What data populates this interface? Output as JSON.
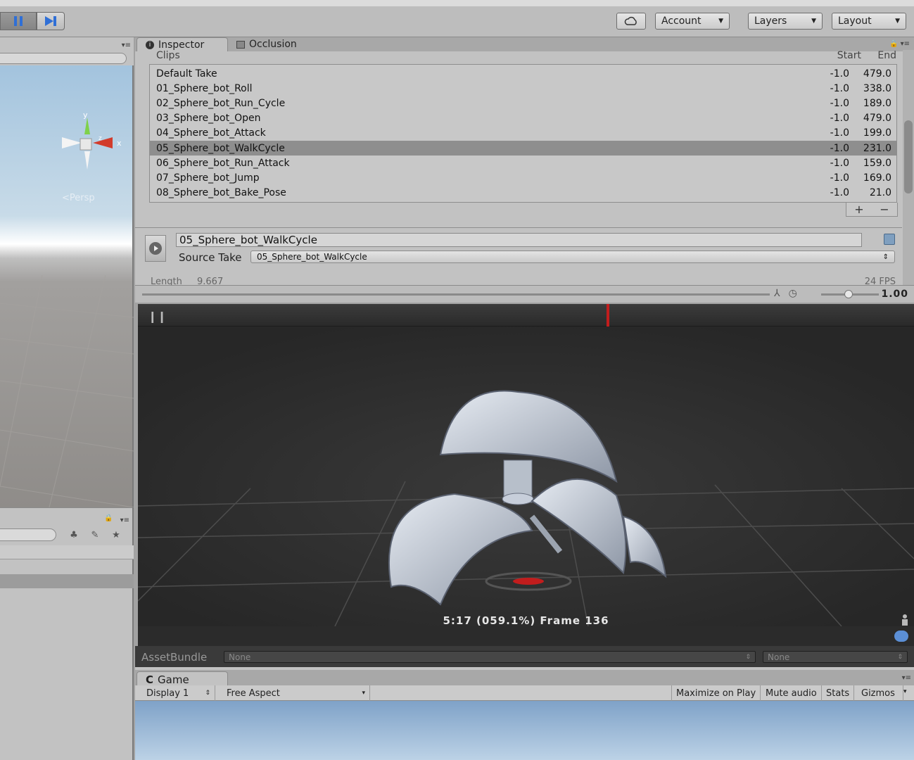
{
  "toolbar": {
    "pause_icon": "pause-icon",
    "step_icon": "step-icon",
    "cloud_icon": "cloud-icon",
    "account_label": "Account",
    "layers_label": "Layers",
    "layout_label": "Layout"
  },
  "scene": {
    "persp_label": "Persp",
    "gizmo_axes": [
      "y",
      "x",
      "z"
    ]
  },
  "inspector": {
    "tabs": [
      {
        "label": "Inspector",
        "icon": "info-icon"
      },
      {
        "label": "Occlusion",
        "icon": "occlusion-icon"
      }
    ],
    "clips": {
      "header": "Clips",
      "start_label": "Start",
      "end_label": "End",
      "rows": [
        {
          "name": "Default Take",
          "start": "-1.0",
          "end": "479.0"
        },
        {
          "name": "01_Sphere_bot_Roll",
          "start": "-1.0",
          "end": "338.0"
        },
        {
          "name": "02_Sphere_bot_Run_Cycle",
          "start": "-1.0",
          "end": "189.0"
        },
        {
          "name": "03_Sphere_bot_Open",
          "start": "-1.0",
          "end": "479.0"
        },
        {
          "name": "04_Sphere_bot_Attack",
          "start": "-1.0",
          "end": "199.0"
        },
        {
          "name": "05_Sphere_bot_WalkCycle",
          "start": "-1.0",
          "end": "231.0"
        },
        {
          "name": "06_Sphere_bot_Run_Attack",
          "start": "-1.0",
          "end": "159.0"
        },
        {
          "name": "07_Sphere_bot_Jump",
          "start": "-1.0",
          "end": "169.0"
        },
        {
          "name": "08_Sphere_bot_Bake_Pose",
          "start": "-1.0",
          "end": "21.0"
        }
      ],
      "selected_index": 5,
      "add_label": "+",
      "remove_label": "−"
    },
    "clip_editor": {
      "name_value": "05_Sphere_bot_WalkCycle",
      "source_take_label": "Source Take",
      "source_take_value": "05_Sphere_bot_WalkCycle",
      "length_label": "Length",
      "length_value": "9.667",
      "fps": "24 FPS"
    }
  },
  "timeline": {
    "speed_value": "1.00"
  },
  "preview": {
    "frame_text": "5:17 (059.1%) Frame 136"
  },
  "assetbundle": {
    "label": "AssetBundle",
    "name_value": "None",
    "variant_value": "None"
  },
  "game": {
    "tab_label": "Game",
    "display_value": "Display 1",
    "aspect_value": "Free Aspect",
    "maximize_label": "Maximize on Play",
    "mute_label": "Mute audio",
    "stats_label": "Stats",
    "gizmos_label": "Gizmos"
  }
}
